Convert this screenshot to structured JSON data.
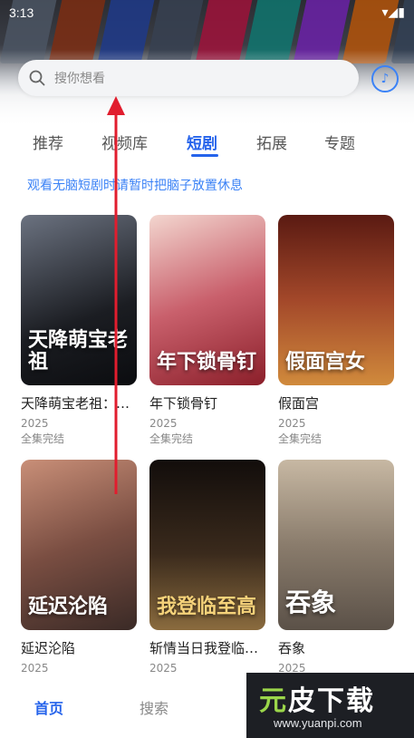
{
  "status_bar": {
    "time": "3:13",
    "icons": "▾◢▮"
  },
  "search": {
    "placeholder": "搜你想看"
  },
  "tabs": [
    {
      "label": "推荐"
    },
    {
      "label": "视频库"
    },
    {
      "label": "短剧"
    },
    {
      "label": "拓展"
    },
    {
      "label": "专题"
    }
  ],
  "notice": "观看无脑短剧时请暂时把脑子放置休息",
  "cards": [
    {
      "title": "天降萌宝老祖：孝子贤孙都跪下",
      "poster_text": "天降萌宝老祖",
      "year": "2025",
      "status": "全集完结",
      "c1": "#1b1d22",
      "c2": "#6b7280"
    },
    {
      "title": "年下锁骨钉",
      "poster_text": "年下锁骨钉",
      "year": "2025",
      "status": "全集完结",
      "c1": "#8b1f2a",
      "c2": "#f3d6cf"
    },
    {
      "title": "假面宫",
      "poster_text": "假面宫女",
      "year": "2025",
      "status": "全集完结",
      "c1": "#5a1a12",
      "c2": "#d08a3c"
    },
    {
      "title": "延迟沦陷",
      "poster_text": "延迟沦陷",
      "year": "2025",
      "status": "",
      "c1": "#3a2a26",
      "c2": "#c98f78"
    },
    {
      "title": "斩情当日我登临至高",
      "poster_text": "我登临至高",
      "year": "2025",
      "status": "",
      "c1": "#120d0b",
      "c2": "#8a6b3e"
    },
    {
      "title": "吞象",
      "poster_text": "吞象",
      "year": "2025",
      "status": "",
      "c1": "#5b5148",
      "c2": "#c7b8a3"
    }
  ],
  "bottom_nav": [
    {
      "label": "首页"
    },
    {
      "label": "搜索"
    }
  ],
  "watermark": {
    "main_a": "元",
    "main_b": "皮下载",
    "url": "www.yuanpi.com"
  },
  "colors": {
    "accent": "#2563eb",
    "annotation_arrow": "#e11d2e"
  }
}
